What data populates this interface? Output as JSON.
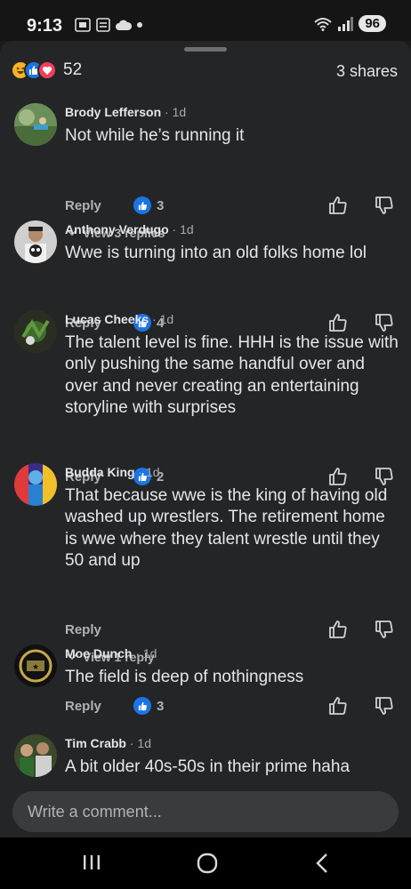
{
  "status": {
    "time": "9:13",
    "battery": "96"
  },
  "post": {
    "reaction_count": "52",
    "shares": "3 shares"
  },
  "composer": {
    "placeholder": "Write a comment..."
  },
  "comments": [
    {
      "author": "Brody Lefferson",
      "time": " · 1d",
      "text": "Not while he’s running it",
      "reply": "Reply",
      "likes": "3",
      "view_replies": "View 3 replies"
    },
    {
      "author": "Anthony Verdugo",
      "time": " · 1d",
      "text": "Wwe is turning into an old folks home lol",
      "reply": "Reply",
      "likes": "4"
    },
    {
      "author": "Lucas Cheeks",
      "time": " · 1d",
      "text": "The talent level is fine. HHH is the issue with only pushing the same handful over and over and never creating an entertaining storyline with surprises",
      "reply": "Reply",
      "likes": "2"
    },
    {
      "author": "Budda King",
      "time": " · 1d",
      "text": "That because wwe is the king of having old washed up wrestlers. The retirement home is wwe where they talent wrestle until they 50 and up",
      "reply": "Reply",
      "view_replies": "View 1 reply"
    },
    {
      "author": "Moe Dunch",
      "time": " · 1d",
      "text": "The field is deep of nothingness",
      "reply": "Reply",
      "likes": "3"
    },
    {
      "author": "Tim Crabb",
      "time": " · 1d",
      "text": "A bit older 40s-50s in their prime haha"
    }
  ],
  "colors": {
    "accent": "#1b74e4",
    "background": "#242526",
    "heart": "#f33e58",
    "haha": "#f7b125"
  },
  "icons": [
    "haha-reaction-icon",
    "like-reaction-icon",
    "love-reaction-icon",
    "thumbs-up-icon",
    "thumbs-down-icon",
    "chevron-down-icon",
    "back-icon",
    "home-icon",
    "recents-icon"
  ]
}
